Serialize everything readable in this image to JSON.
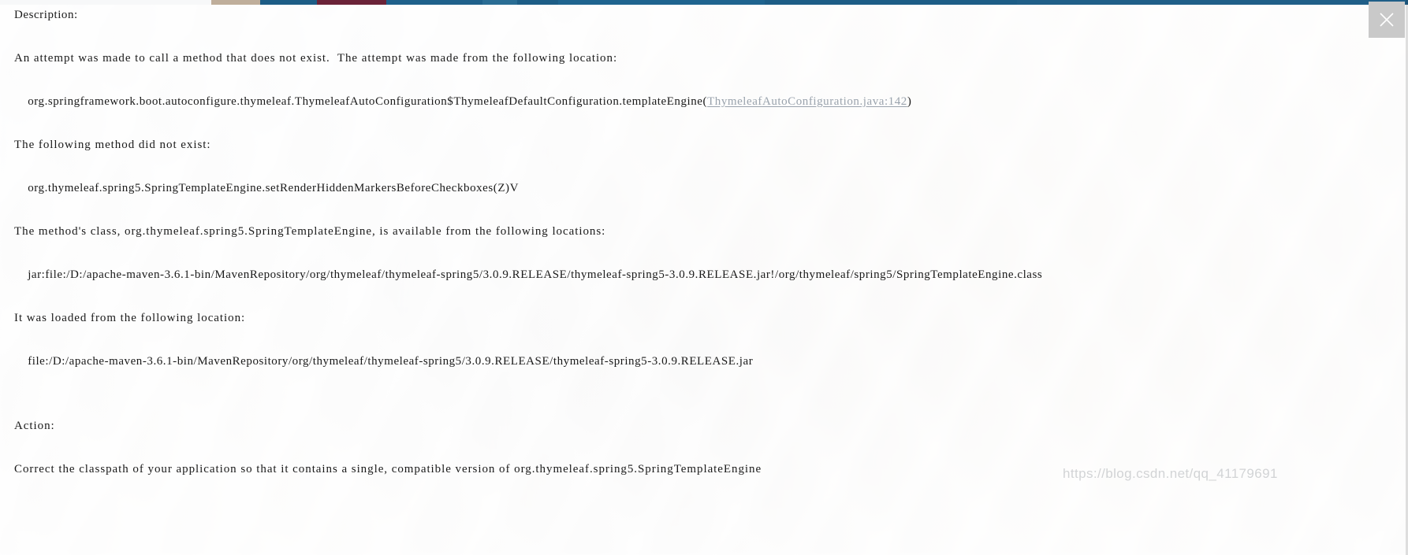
{
  "window": {
    "close_button_label": "×",
    "close_icon": "close-icon"
  },
  "error_page": {
    "description_heading": "Description:",
    "summary": "An attempt was made to call a method that does not exist.  The attempt was made from the following location:",
    "location_prefix": "    org.springframework.boot.autoconfigure.thymeleaf.ThymeleafAutoConfiguration$ThymeleafDefaultConfiguration.templateEngine(",
    "location_link": "ThymeleafAutoConfiguration.java:142",
    "location_suffix": ")",
    "missing_method_heading": "The following method did not exist:",
    "missing_method": "    org.thymeleaf.spring5.SpringTemplateEngine.setRenderHiddenMarkersBeforeCheckboxes(Z)V",
    "class_available_heading": "The method's class, org.thymeleaf.spring5.SpringTemplateEngine, is available from the following locations:",
    "jar_location": "    jar:file:/D:/apache-maven-3.6.1-bin/MavenRepository/org/thymeleaf/thymeleaf-spring5/3.0.9.RELEASE/thymeleaf-spring5-3.0.9.RELEASE.jar!/org/thymeleaf/spring5/SpringTemplateEngine.class",
    "loaded_from_heading": "It was loaded from the following location:",
    "loaded_from": "    file:/D:/apache-maven-3.6.1-bin/MavenRepository/org/thymeleaf/thymeleaf-spring5/3.0.9.RELEASE/thymeleaf-spring5-3.0.9.RELEASE.jar",
    "action_heading": "Action:",
    "action_text": "Correct the classpath of your application so that it contains a single, compatible version of org.thymeleaf.spring5.SpringTemplateEngine"
  },
  "watermark": {
    "text": "https://blog.csdn.net/qq_41179691"
  },
  "colors": {
    "text": "#1a1a1a",
    "link": "#9aa3ad",
    "close_button_bg": "#c9c9c9",
    "close_icon": "#ffffff",
    "watermark": "#969ba0"
  }
}
